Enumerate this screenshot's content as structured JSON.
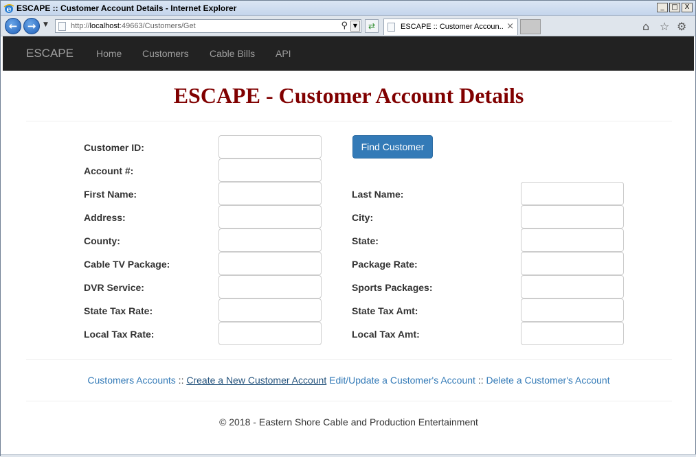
{
  "window": {
    "title": "ESCAPE :: Customer Account Details - Internet Explorer",
    "minimize": "_",
    "maximize": "□",
    "close": "X"
  },
  "browser": {
    "url_prefix": "http://",
    "url_host": "localhost",
    "url_path": ":49663/Customers/Get",
    "tab_label": "ESCAPE :: Customer Accoun...",
    "icons": [
      "back-icon",
      "forward-icon",
      "search-icon",
      "refresh-icon",
      "close-icon",
      "home-icon",
      "star-icon",
      "gear-icon"
    ]
  },
  "navbar": {
    "brand": "ESCAPE",
    "links": [
      "Home",
      "Customers",
      "Cable Bills",
      "API"
    ]
  },
  "page": {
    "title": "ESCAPE - Customer Account Details",
    "title_color": "#800000"
  },
  "form": {
    "left_fields": [
      {
        "label": "Customer ID:",
        "value": ""
      },
      {
        "label": "Account #:",
        "value": ""
      },
      {
        "label": "First Name:",
        "value": ""
      },
      {
        "label": "Address:",
        "value": ""
      },
      {
        "label": "County:",
        "value": ""
      },
      {
        "label": "Cable TV Package:",
        "value": ""
      },
      {
        "label": "DVR Service:",
        "value": ""
      },
      {
        "label": "State Tax Rate:",
        "value": ""
      },
      {
        "label": "Local Tax Rate:",
        "value": ""
      }
    ],
    "right_fields": [
      {
        "label": "Last Name:",
        "value": ""
      },
      {
        "label": "City:",
        "value": ""
      },
      {
        "label": "State:",
        "value": ""
      },
      {
        "label": "Package Rate:",
        "value": ""
      },
      {
        "label": "Sports Packages:",
        "value": ""
      },
      {
        "label": "State Tax Amt:",
        "value": ""
      },
      {
        "label": "Local Tax Amt:",
        "value": ""
      }
    ],
    "find_button": "Find Customer",
    "button_color": "#337ab7"
  },
  "footer": {
    "links": {
      "customers_accounts": "Customers Accounts",
      "sep1": " :: ",
      "create": "Create a New Customer Account",
      "edit": "Edit/Update a Customer's Account",
      "sep2": " :: ",
      "delete": "Delete a Customer's Account"
    },
    "copyright": "© 2018 - Eastern Shore Cable and Production Entertainment",
    "link_color": "#337ab7"
  }
}
